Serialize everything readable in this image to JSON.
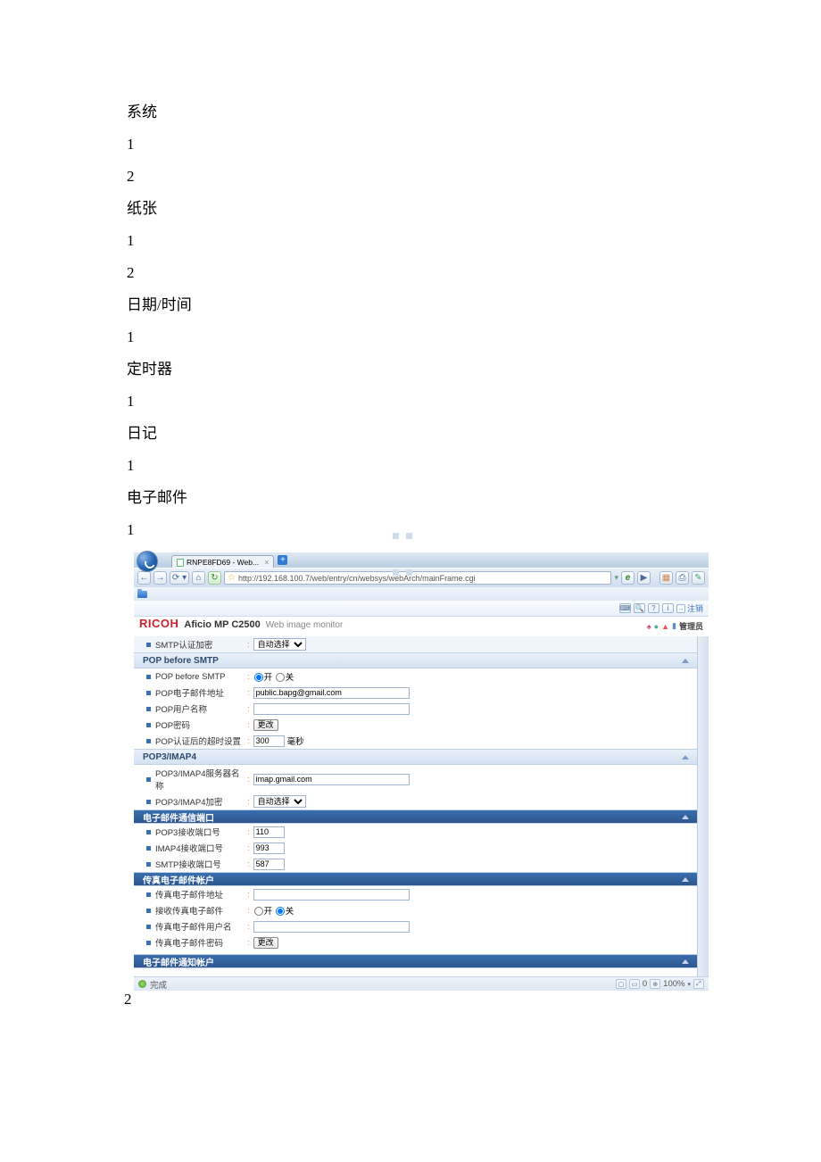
{
  "textBlocks": [
    "系统",
    "1",
    "2",
    "纸张",
    "1",
    "2",
    "日期/时间",
    "1",
    "定时器",
    "1",
    "日记",
    "1",
    "电子邮件",
    "1"
  ],
  "pageNumber": "2",
  "browser": {
    "tabTitle": "RNPE8FD69 - Web...",
    "url": "http://192.168.100.7/web/entry/cn/websys/webArch/mainFrame.cgi",
    "status": "完成",
    "zoom": "100%",
    "popupCount": "0"
  },
  "ricoh": {
    "brand": "RICOH",
    "model": "Aficio MP C2500",
    "subtitle": "Web image monitor",
    "logout": "注销",
    "role": "管理员",
    "smtpAuthLabel": "SMTP认证加密",
    "autoSelect": "自动选择",
    "sections": {
      "popBeforeSmtp": "POP before SMTP",
      "popImap": "POP3/IMAP4",
      "emailPort": "电子邮件通信端口",
      "faxAccount": "传真电子邮件帐户",
      "notifyAccount": "电子邮件通知帐户"
    },
    "labels": {
      "popBeforeSmtp": "POP before SMTP",
      "popEmail": "POP电子邮件地址",
      "popUser": "POP用户名称",
      "popPassword": "POP密码",
      "popTimeout": "POP认证后的超时设置",
      "popImapServer": "POP3/IMAP4服务器名称",
      "popImapCrypt": "POP3/IMAP4加密",
      "pop3Port": "POP3接收端口号",
      "imap4Port": "IMAP4接收端口号",
      "smtpPort": "SMTP接收端口号",
      "faxEmail": "传真电子邮件地址",
      "faxReceive": "接收传真电子邮件",
      "faxUser": "传真电子邮件用户名",
      "faxPassword": "传真电子邮件密码"
    },
    "values": {
      "on": "开",
      "off": "关",
      "popEmail": "public.bapg@gmail.com",
      "change": "更改",
      "timeout": "300",
      "msec": "毫秒",
      "imapServer": "imap.gmail.com",
      "pop3Port": "110",
      "imap4Port": "993",
      "smtpPort": "587"
    }
  }
}
